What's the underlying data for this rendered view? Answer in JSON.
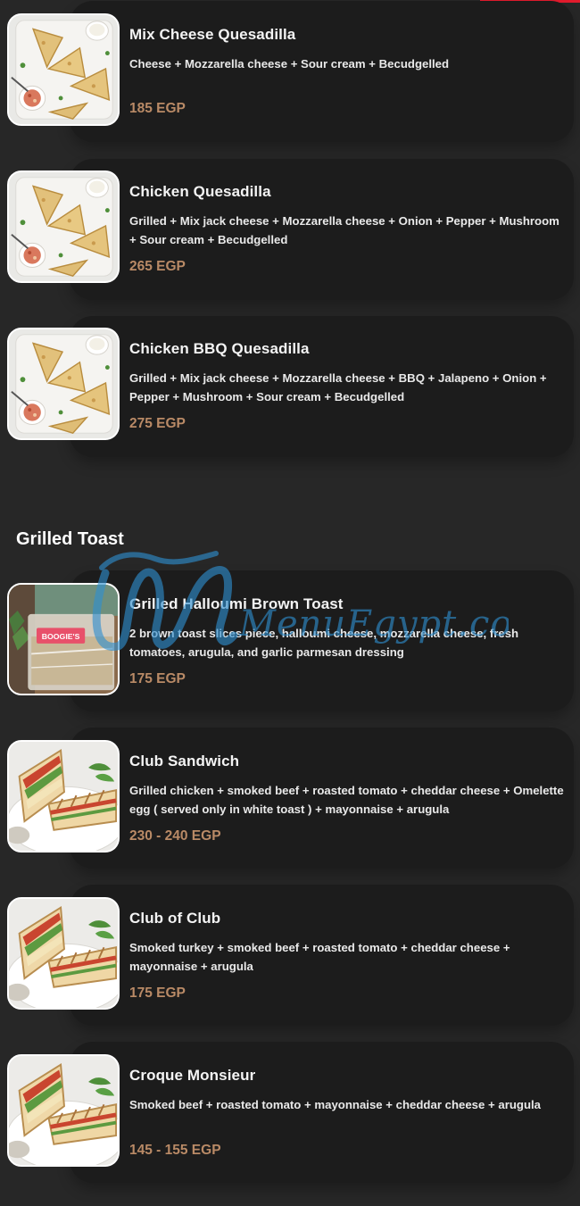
{
  "sections": [
    {
      "items": [
        {
          "name": "Mix Cheese Quesadilla",
          "description": "Cheese + Mozzarella cheese + Sour cream + Becudgelled",
          "price": "185 EGP",
          "image_icon": "quesadilla-icon"
        },
        {
          "name": "Chicken Quesadilla",
          "description": "Grilled + Mix jack cheese + Mozzarella cheese + Onion + Pepper + Mushroom + Sour cream + Becudgelled",
          "price": "265 EGP",
          "image_icon": "quesadilla-icon"
        },
        {
          "name": "Chicken BBQ Quesadilla",
          "description": "Grilled + Mix jack cheese + Mozzarella cheese + BBQ + Jalapeno + Onion + Pepper + Mushroom + Sour cream + Becudgelled",
          "price": "275 EGP",
          "image_icon": "quesadilla-icon"
        }
      ]
    },
    {
      "title": "Grilled Toast",
      "items": [
        {
          "name": "Grilled Halloumi Brown Toast",
          "description": "2 brown toast slices piece, halloumi cheese, mozzarella cheese, fresh tomatoes, arugula, and garlic parmesan dressing",
          "price": "175 EGP",
          "image_icon": "wrapped-toast-icon",
          "image_label": "BOOGIE'S"
        },
        {
          "name": "Club Sandwich",
          "description": "Grilled chicken + smoked beef + roasted tomato + cheddar cheese + Omelette egg ( served only in white toast ) + mayonnaise + arugula",
          "price": "230 - 240 EGP",
          "image_icon": "club-sandwich-icon"
        },
        {
          "name": "Club of Club",
          "description": "Smoked turkey + smoked beef + roasted tomato + cheddar cheese + mayonnaise + arugula",
          "price": "175 EGP",
          "image_icon": "club-sandwich-icon"
        },
        {
          "name": "Croque Monsieur",
          "description": "Smoked beef + roasted tomato + mayonnaise + cheddar cheese + arugula",
          "price": "145 - 155 EGP",
          "image_icon": "club-sandwich-icon"
        }
      ]
    }
  ],
  "watermark": "MenuEgypt.com",
  "colors": {
    "background": "#272727",
    "card": "#1c1c1c",
    "price": "#b98a66",
    "accent": "#e21b2d",
    "watermark": "#2f8fd0"
  }
}
